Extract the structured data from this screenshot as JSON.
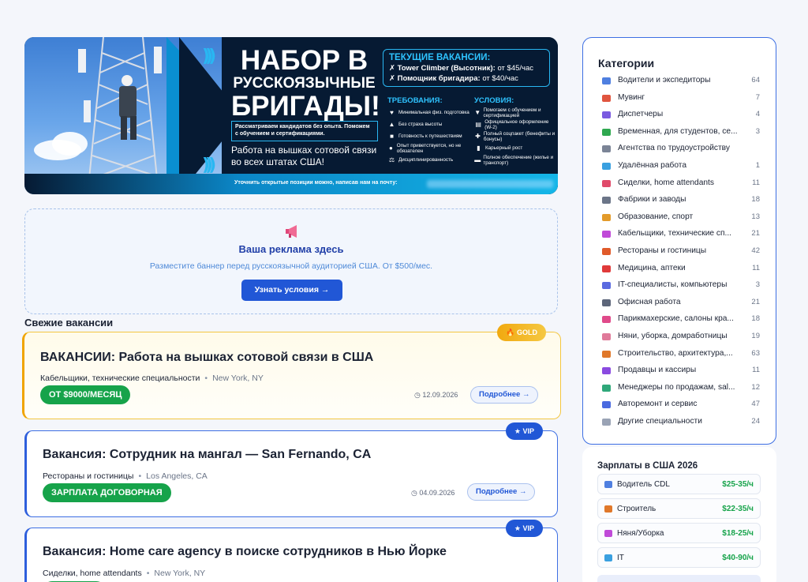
{
  "banner": {
    "title_line1": "НАБОР В",
    "title_line2": "РУССКОЯЗЫЧНЫЕ",
    "title_line3": "БРИГАДЫ!",
    "note": "Рассматриваем кандидатов без опыта. Поможем с обучением и сертификациями.",
    "subtitle": "Работа на вышках сотовой связи во всех штатах США!",
    "vacancies_heading": "ТЕКУЩИЕ ВАКАНСИИ:",
    "vacancy1_name": "Tower Climber (Высотник):",
    "vacancy1_pay": "от $45/час",
    "vacancy2_name": "Помощник бригадира:",
    "vacancy2_pay": "от $40/час",
    "requirements_heading": "ТРЕБОВАНИЯ:",
    "requirements": [
      "Минимальная физ. подготовка",
      "Без страха высоты",
      "Готовность к путешествиям",
      "Опыт приветствуется, но не обязателен",
      "Дисциплинированность"
    ],
    "conditions_heading": "УСЛОВИЯ:",
    "conditions": [
      "Помогаем с обучением и сертификацией",
      "Официальное оформление (W-2)",
      "Полный соцпакет (бенефиты и бонусы)",
      "Карьерный рост",
      "Полное обеспечение (жилье и транспорт)"
    ],
    "footer": "Уточнить открытые позиции можно, написав нам на почту:"
  },
  "ad": {
    "icon": "megaphone-icon",
    "title": "Ваша реклама здесь",
    "subtitle": "Разместите баннер перед русскоязычной аудиторией США. От $500/мес.",
    "button": "Узнать условия →"
  },
  "jobs": {
    "section_title": "Свежие вакансии",
    "items": [
      {
        "badge": "GOLD",
        "title": "ВАКАНСИИ: Работа на вышках сотовой связи в США",
        "category": "Кабельщики, технические специальности",
        "location": "New York, NY",
        "salary": "ОТ $9000/МЕСЯЦ",
        "date": "12.09.2026",
        "more": "Подробнее →"
      },
      {
        "badge": "★ VIP",
        "title": "Вакансия: Сотрудник на мангал — San Fernando, CA",
        "category": "Рестораны и гостиницы",
        "location": "Los Angeles, CA",
        "salary": "ЗАРПЛАТА ДОГОВОРНАЯ",
        "date": "04.09.2026",
        "more": "Подробнее →"
      },
      {
        "badge": "★ VIP",
        "title": "Вакансия: Home care agency в поиске сотрудников в Нью Йорке",
        "category": "Сиделки, home attendants",
        "location": "New York, NY"
      }
    ]
  },
  "sidebar": {
    "categories_title": "Категории",
    "categories": [
      {
        "label": "Водители и экспедиторы",
        "count": "64",
        "color": "#4f7fe0"
      },
      {
        "label": "Мувинг",
        "count": "7",
        "color": "#e0553f"
      },
      {
        "label": "Диспетчеры",
        "count": "4",
        "color": "#7a5ae0"
      },
      {
        "label": "Временная, для студентов, се...",
        "count": "3",
        "color": "#2fa84f"
      },
      {
        "label": "Агентства по трудоустройству",
        "count": "",
        "color": "#7b8496"
      },
      {
        "label": "Удалённая работа",
        "count": "1",
        "color": "#3aa0e0"
      },
      {
        "label": "Сиделки, home attendants",
        "count": "11",
        "color": "#e04a6a"
      },
      {
        "label": "Фабрики и заводы",
        "count": "18",
        "color": "#6b7588"
      },
      {
        "label": "Образование, спорт",
        "count": "13",
        "color": "#e39b2a"
      },
      {
        "label": "Кабельщики, технические сп...",
        "count": "21",
        "color": "#c04ad8"
      },
      {
        "label": "Рестораны и гостиницы",
        "count": "42",
        "color": "#e05a2a"
      },
      {
        "label": "Медицина, аптеки",
        "count": "11",
        "color": "#e03a3a"
      },
      {
        "label": "IT-специалисты, компьютеры",
        "count": "3",
        "color": "#5a6ae0"
      },
      {
        "label": "Офисная работа",
        "count": "21",
        "color": "#5d667a"
      },
      {
        "label": "Парикмахерские, салоны кра...",
        "count": "18",
        "color": "#e04a8a"
      },
      {
        "label": "Няни, уборка, домработницы",
        "count": "19",
        "color": "#e07a9a"
      },
      {
        "label": "Строительство, архитектура,...",
        "count": "63",
        "color": "#e0782a"
      },
      {
        "label": "Продавцы и кассиры",
        "count": "11",
        "color": "#8a4ae0"
      },
      {
        "label": "Менеджеры по продажам, sal...",
        "count": "12",
        "color": "#2fa87a"
      },
      {
        "label": "Авторемонт и сервис",
        "count": "47",
        "color": "#4a6ae0"
      },
      {
        "label": "Другие специальности",
        "count": "24",
        "color": "#9aa3b5"
      }
    ],
    "salaries_title": "Зарплаты в США 2026",
    "salaries": [
      {
        "label": "Водитель CDL",
        "value": "$25-35/ч",
        "color": "#4f7fe0"
      },
      {
        "label": "Строитель",
        "value": "$22-35/ч",
        "color": "#e0782a"
      },
      {
        "label": "Няня/Уборка",
        "value": "$18-25/ч",
        "color": "#c04ad8"
      },
      {
        "label": "IT",
        "value": "$40-90/ч",
        "color": "#3aa0e0"
      }
    ]
  }
}
